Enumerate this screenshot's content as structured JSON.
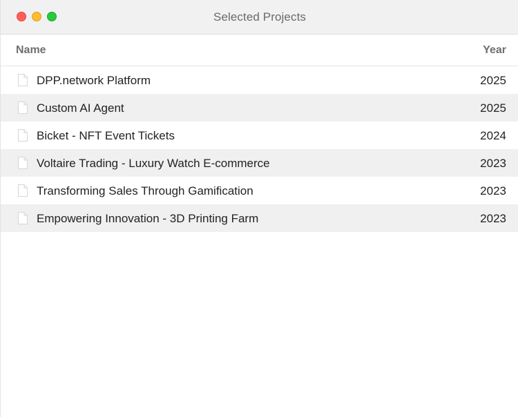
{
  "window": {
    "title": "Selected Projects"
  },
  "table": {
    "headers": {
      "name": "Name",
      "year": "Year"
    },
    "rows": [
      {
        "name": "DPP.network Platform",
        "year": "2025",
        "icon": "file-icon"
      },
      {
        "name": "Custom AI Agent",
        "year": "2025",
        "icon": "file-icon"
      },
      {
        "name": "Bicket - NFT Event Tickets",
        "year": "2024",
        "icon": "file-icon"
      },
      {
        "name": "Voltaire Trading - Luxury Watch E-commerce",
        "year": "2023",
        "icon": "file-icon"
      },
      {
        "name": "Transforming Sales Through Gamification",
        "year": "2023",
        "icon": "file-icon"
      },
      {
        "name": "Empowering Innovation - 3D Printing Farm",
        "year": "2023",
        "icon": "file-icon"
      }
    ]
  },
  "colors": {
    "close": "#ff5f57",
    "minimize": "#febc2e",
    "maximize": "#28c840",
    "alt_row": "#f0f0f0"
  }
}
